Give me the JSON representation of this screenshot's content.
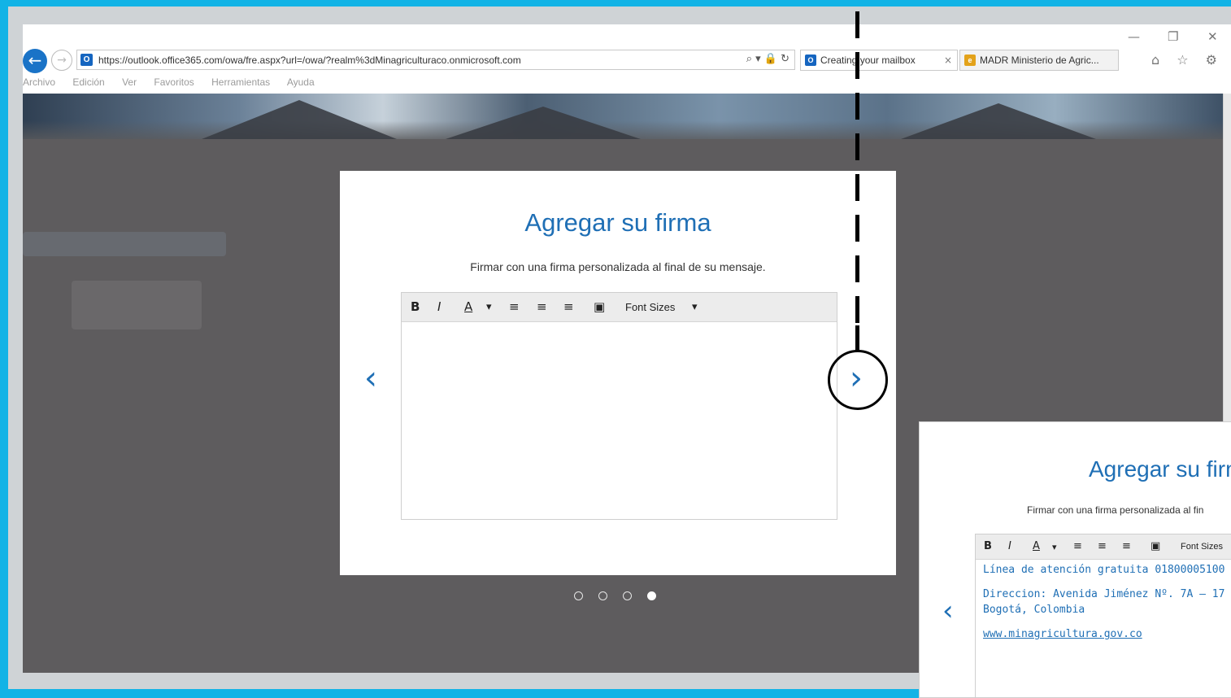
{
  "window": {
    "minimize_icon": "—",
    "restore_icon": "❐",
    "close_icon": "✕"
  },
  "address_bar": {
    "favicon_letter": "O",
    "url": "https://outlook.office365.com/owa/fre.aspx?url=/owa/?realm%3dMinagriculturaco.onmicrosoft.com",
    "tools": "⌕ ▾ 🔒 ↻"
  },
  "tabs": [
    {
      "label": "Creating your mailbox",
      "close": "×",
      "icon_color": "#1565c0",
      "icon_letter": "O"
    },
    {
      "label": "MADR Ministerio de Agric...",
      "icon_color": "#e3a21a",
      "icon_letter": "e"
    }
  ],
  "toolbar_icons": "⌂ ☆ ⚙",
  "menu": [
    "Archivo",
    "Edición",
    "Ver",
    "Favoritos",
    "Herramientas",
    "Ayuda"
  ],
  "dialog": {
    "title": "Agregar su firma",
    "subtitle": "Firmar con una firma personalizada al final de su mensaje.",
    "editor_toolbar": {
      "bold": "B",
      "italic": "I",
      "font_color": "A",
      "dropdown_arrow": "▾",
      "align_left": "≡",
      "align_center": "≡",
      "align_right": "≡",
      "image": "▣",
      "font_sizes": "Font Sizes",
      "font_sizes_arrow": "▾"
    },
    "prev_arrow": "‹",
    "next_arrow": "›",
    "pager": {
      "total": 4,
      "active_index": 3
    }
  },
  "dialog_zoom": {
    "title": "Agregar su firm",
    "subtitle": "Firmar con una firma personalizada al fin",
    "editor_toolbar": {
      "bold": "B",
      "italic": "I",
      "font_color": "A",
      "dropdown_arrow": "▾",
      "align_left": "≡",
      "align_center": "≡",
      "align_right": "≡",
      "image": "▣",
      "font_sizes": "Font Sizes"
    },
    "signature_lines": [
      "Línea de atención gratuita 01800005100",
      "Direccion: Avenida Jiménez Nº. 7A – 17",
      "Bogotá, Colombia",
      "www.minagricultura.gov.co"
    ],
    "prev_arrow": "‹"
  },
  "colors": {
    "frame_border": "#12b3e6",
    "accent_blue": "#1f6fb5",
    "overlay": "#5e5c5e"
  }
}
